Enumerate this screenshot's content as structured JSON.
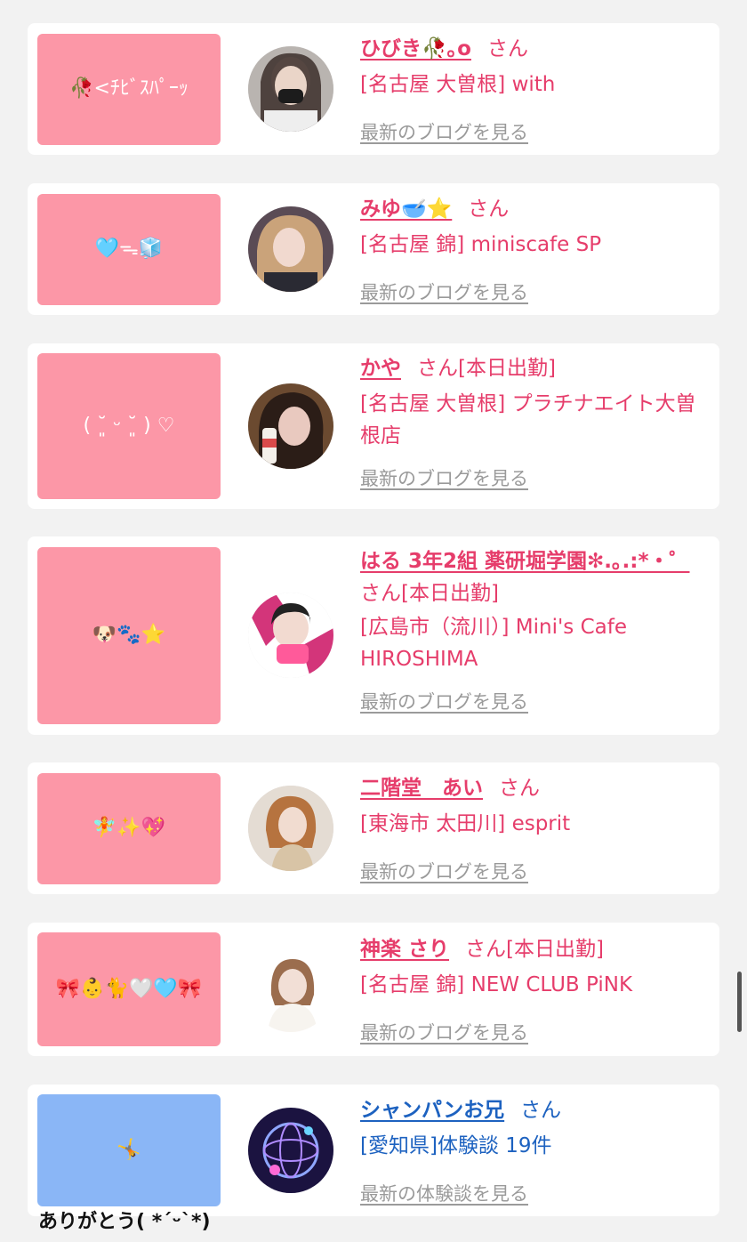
{
  "cards": [
    {
      "bubble": "🥀<ﾁﾋﾞｽﾊﾟｰｯ",
      "name": "ひびき🥀｡o",
      "san": "さん",
      "status": "",
      "shop": "[名古屋 大曽根] with",
      "link": "最新のブログを見る"
    },
    {
      "bubble": "🩵ᯓ🧊",
      "name": "みゆ🥣⭐",
      "san": "さん",
      "status": "",
      "shop": "[名古屋 錦] miniscafe SP",
      "link": "最新のブログを見る"
    },
    {
      "bubble": "( ˘͈ ᵕ ˘͈ ) ♡",
      "name": "かや",
      "san": "さん",
      "status": "[本日出勤]",
      "shop": "[名古屋 大曽根] プラチナエイト大曽根店",
      "link": "最新のブログを見る"
    },
    {
      "bubble": "🐶🐾⭐",
      "name": "はる 3年2組 薬研堀学園✻.｡.:*・゜",
      "san": "さん",
      "status": "[本日出勤]",
      "shop": "[広島市（流川）] Mini's Cafe HIROSHIMA",
      "link": "最新のブログを見る"
    },
    {
      "bubble": "🧚✨💖",
      "name": "二階堂　あい",
      "san": "さん",
      "status": "",
      "shop": "[東海市 太田川] esprit",
      "link": "最新のブログを見る"
    },
    {
      "bubble": "🎀👶🐈🤍🩵🎀",
      "name": "神楽 さり",
      "san": "さん",
      "status": "[本日出勤]",
      "shop": "[名古屋 錦] NEW CLUB PiNK",
      "link": "最新のブログを見る"
    },
    {
      "bubble": "🤸",
      "name": "シャンパンお兄",
      "san": "さん",
      "status": "",
      "shop": "[愛知県]体験談 19件",
      "link": "最新の体験談を見る"
    }
  ],
  "footer_text": "ありがとう( *ˊᵕˋ*)",
  "colors": {
    "accent_pink": "#e63d6b",
    "bubble_pink": "#fc97a7",
    "accent_blue": "#1d62c0",
    "bubble_blue": "#8ab6f6",
    "link_gray": "#9a9a9a"
  }
}
